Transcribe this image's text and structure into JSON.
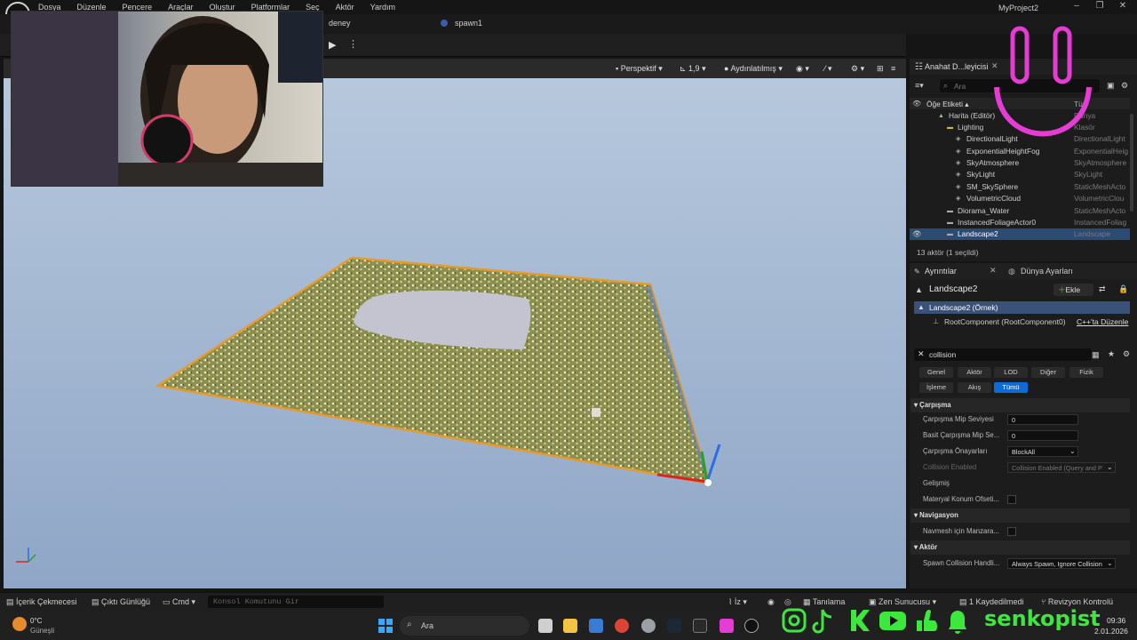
{
  "menu": [
    "Dosya",
    "Düzenle",
    "Pencere",
    "Araçlar",
    "Oluştur",
    "Platformlar",
    "Seç",
    "Aktör",
    "Yardım"
  ],
  "project_title": "MyProject2",
  "level_tabs": [
    "deney",
    "spawn1"
  ],
  "viewport": {
    "perspective": "Perspektif",
    "fov": "1,9",
    "lit": "Aydınlatılmış"
  },
  "outliner": {
    "tab": "Anahat D...leyicisi",
    "search_placeholder": "Ara",
    "col_label": "Öğe Etiketi",
    "col_type": "Tür",
    "rows": [
      {
        "name": "Harita (Editör)",
        "type": "Dünya",
        "indent": 1
      },
      {
        "name": "Lighting",
        "type": "Klasör",
        "indent": 2
      },
      {
        "name": "DirectionalLight",
        "type": "DirectionalLight",
        "indent": 3
      },
      {
        "name": "ExponentialHeightFog",
        "type": "ExponentialHeig",
        "indent": 3
      },
      {
        "name": "SkyAtmosphere",
        "type": "SkyAtmosphere",
        "indent": 3
      },
      {
        "name": "SkyLight",
        "type": "SkyLight",
        "indent": 3
      },
      {
        "name": "SM_SkySphere",
        "type": "StaticMeshActo",
        "indent": 3
      },
      {
        "name": "VolumetricCloud",
        "type": "VolumetricClou",
        "indent": 3
      },
      {
        "name": "Diorama_Water",
        "type": "StaticMeshActo",
        "indent": 2
      },
      {
        "name": "InstancedFoliageActor0",
        "type": "InstancedFoliag",
        "indent": 2
      },
      {
        "name": "Landscape2",
        "type": "Landscape",
        "indent": 2,
        "selected": true
      }
    ],
    "footer": "13 aktör (1 seçildi)"
  },
  "details": {
    "tab1": "Ayrıntılar",
    "tab2": "Dünya Ayarları",
    "actor_name": "Landscape2",
    "add_label": "Ekle",
    "instance": "Landscape2 (Örnek)",
    "root_component": "RootComponent (RootComponent0)",
    "edit_cpp": "C++'ta Düzenle",
    "search_value": "collision",
    "chips_row1": [
      "Genel",
      "Aktör",
      "LOD",
      "Diğer",
      "Fizik"
    ],
    "chips_row2": [
      "İşleme",
      "Akış",
      "Tümü"
    ],
    "sections": [
      {
        "title": "Çarpışma"
      },
      {
        "title": "Navigasyon"
      },
      {
        "title": "Aktör"
      }
    ],
    "props": {
      "mip_level_label": "Çarpışma Mip Seviyesi",
      "mip_level_value": "0",
      "simple_mip_label": "Basit Çarpışma Mip Se...",
      "simple_mip_value": "0",
      "presets_label": "Çarpışma Önayarları",
      "presets_value": "BlockAll",
      "enabled_label": "Collision Enabled",
      "enabled_value": "Collision Enabled (Query and P",
      "advanced_label": "Gelişmiş",
      "material_offset_label": "Materyal Konum Ofseti...",
      "navmesh_label": "Navmesh için Manzara...",
      "spawn_label": "Spawn Collision Handli...",
      "spawn_value": "Always Spawn, Ignore Collision"
    }
  },
  "statusbar": {
    "content_drawer": "İçerik Çekmecesi",
    "output_log": "Çıktı Günlüğü",
    "cmd": "Cmd",
    "console_placeholder": "Konsol Komutunu Gir",
    "derived": "Tanılama",
    "zen": "Zen Sunucusu",
    "saved": "1 Kaydedilmedi",
    "revision": "Revizyon Kontrolü"
  },
  "taskbar": {
    "weather_temp": "0°C",
    "weather_desc": "Güneşli",
    "search": "Ara",
    "time": "09:36",
    "date": "2.01.2026"
  },
  "overlay": {
    "brand": "senkopist"
  },
  "colors": {
    "sky": "#9db3cf",
    "landscape": "#8b8e4f",
    "selection": "#2d4a72",
    "accent_blue": "#0d6ad6",
    "social_green": "#3ce83c",
    "pink": "#e63bd4"
  }
}
